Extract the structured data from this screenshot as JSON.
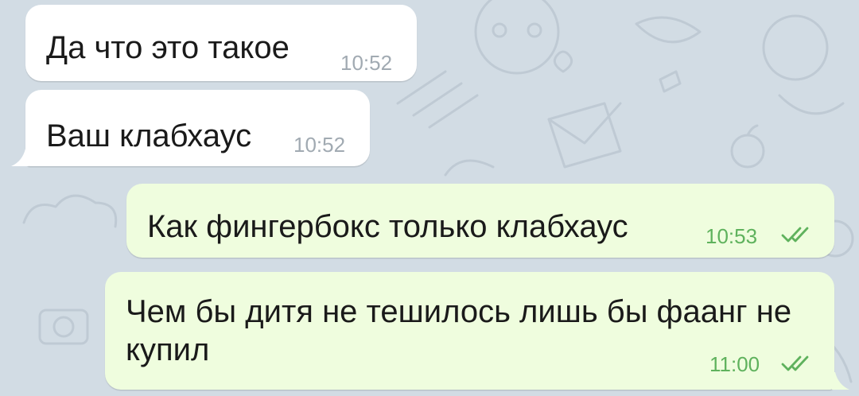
{
  "messages": [
    {
      "id": "m1",
      "direction": "incoming",
      "text": "Да что это такое",
      "time": "10:52"
    },
    {
      "id": "m2",
      "direction": "incoming",
      "text": "Ваш клабхаус",
      "time": "10:52"
    },
    {
      "id": "m3",
      "direction": "outgoing",
      "text": "Как фингербокс только клабхаус",
      "time": "10:53",
      "status": "read"
    },
    {
      "id": "m4",
      "direction": "outgoing",
      "text": "Чем бы дитя не тешилось лишь бы фаанг не купил",
      "time": "11:00",
      "status": "read"
    }
  ],
  "colors": {
    "wallpaper": "#d2dce4",
    "incoming_bubble": "#ffffff",
    "outgoing_bubble": "#effdde",
    "incoming_time": "#a1aab2",
    "outgoing_time": "#5fb25d",
    "read_ticks": "#5fb25d"
  },
  "icons": {
    "read_status": "double-check-icon"
  }
}
